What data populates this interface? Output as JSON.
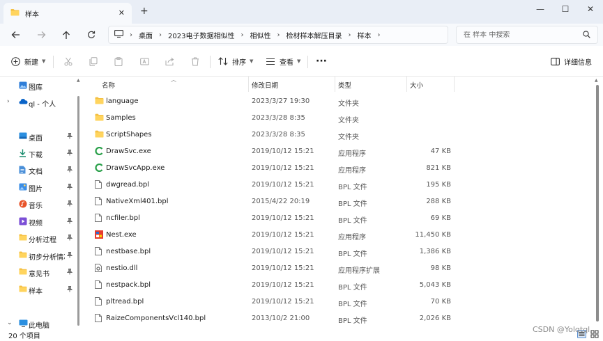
{
  "window": {
    "tab_title": "样本",
    "minimize": "—",
    "maximize": "☐",
    "close": "✕"
  },
  "address": {
    "breadcrumbs": [
      "桌面",
      "2023电子数据相似性",
      "相似性",
      "检材样本解压目录",
      "样本"
    ],
    "search_placeholder": "在 样本 中搜索"
  },
  "toolbar": {
    "new_label": "新建",
    "sort_label": "排序",
    "view_label": "查看",
    "more_label": "···",
    "details_label": "详细信息"
  },
  "sidebar": {
    "items": [
      {
        "label": "图库",
        "icon": "gallery-icon",
        "pinned": false,
        "expand": false
      },
      {
        "label": "ql - 个人",
        "icon": "onedrive-icon",
        "pinned": false,
        "expand": true
      },
      {
        "label": "桌面",
        "icon": "desktop-icon",
        "pinned": true,
        "expand": false
      },
      {
        "label": "下载",
        "icon": "download-icon",
        "pinned": true,
        "expand": false
      },
      {
        "label": "文档",
        "icon": "documents-icon",
        "pinned": true,
        "expand": false
      },
      {
        "label": "图片",
        "icon": "pictures-icon",
        "pinned": true,
        "expand": false
      },
      {
        "label": "音乐",
        "icon": "music-icon",
        "pinned": true,
        "expand": false
      },
      {
        "label": "视频",
        "icon": "videos-icon",
        "pinned": true,
        "expand": false
      },
      {
        "label": "分析过程",
        "icon": "folder-icon",
        "pinned": true,
        "expand": false
      },
      {
        "label": "初步分析情况",
        "icon": "folder-icon",
        "pinned": true,
        "expand": false
      },
      {
        "label": "意见书",
        "icon": "folder-icon",
        "pinned": true,
        "expand": false
      },
      {
        "label": "样本",
        "icon": "folder-icon",
        "pinned": true,
        "expand": false
      },
      {
        "label": "此电脑",
        "icon": "this-pc-icon",
        "pinned": false,
        "expand": true
      }
    ]
  },
  "columns": {
    "name": "名称",
    "date": "修改日期",
    "type": "类型",
    "size": "大小"
  },
  "files": [
    {
      "name": "language",
      "date": "2023/3/27 19:30",
      "type": "文件夹",
      "size": "",
      "icon": "folder-icon"
    },
    {
      "name": "Samples",
      "date": "2023/3/28 8:35",
      "type": "文件夹",
      "size": "",
      "icon": "folder-icon"
    },
    {
      "name": "ScriptShapes",
      "date": "2023/3/28 8:35",
      "type": "文件夹",
      "size": "",
      "icon": "folder-icon"
    },
    {
      "name": "DrawSvc.exe",
      "date": "2019/10/12 15:21",
      "type": "应用程序",
      "size": "47 KB",
      "icon": "drawsvc-app-icon"
    },
    {
      "name": "DrawSvcApp.exe",
      "date": "2019/10/12 15:21",
      "type": "应用程序",
      "size": "821 KB",
      "icon": "drawsvc-app-icon"
    },
    {
      "name": "dwgread.bpl",
      "date": "2019/10/12 15:21",
      "type": "BPL 文件",
      "size": "195 KB",
      "icon": "file-icon"
    },
    {
      "name": "NativeXml401.bpl",
      "date": "2015/4/22 20:19",
      "type": "BPL 文件",
      "size": "288 KB",
      "icon": "file-icon"
    },
    {
      "name": "ncfiler.bpl",
      "date": "2019/10/12 15:21",
      "type": "BPL 文件",
      "size": "69 KB",
      "icon": "file-icon"
    },
    {
      "name": "Nest.exe",
      "date": "2019/10/12 15:21",
      "type": "应用程序",
      "size": "11,450 KB",
      "icon": "nest-app-icon"
    },
    {
      "name": "nestbase.bpl",
      "date": "2019/10/12 15:21",
      "type": "BPL 文件",
      "size": "1,386 KB",
      "icon": "file-icon"
    },
    {
      "name": "nestio.dll",
      "date": "2019/10/12 15:21",
      "type": "应用程序扩展",
      "size": "98 KB",
      "icon": "dll-icon"
    },
    {
      "name": "nestpack.bpl",
      "date": "2019/10/12 15:21",
      "type": "BPL 文件",
      "size": "5,043 KB",
      "icon": "file-icon"
    },
    {
      "name": "pltread.bpl",
      "date": "2019/10/12 15:21",
      "type": "BPL 文件",
      "size": "70 KB",
      "icon": "file-icon"
    },
    {
      "name": "RaizeComponentsVcl140.bpl",
      "date": "2013/10/2 21:00",
      "type": "BPL 文件",
      "size": "2,026 KB",
      "icon": "file-icon"
    }
  ],
  "status": {
    "item_count": "20 个项目"
  },
  "watermark": "CSDN @Yolqtql",
  "colors": {
    "folder": "#f4c042",
    "accent": "#0067c0",
    "titlebar": "#e9eef6"
  }
}
